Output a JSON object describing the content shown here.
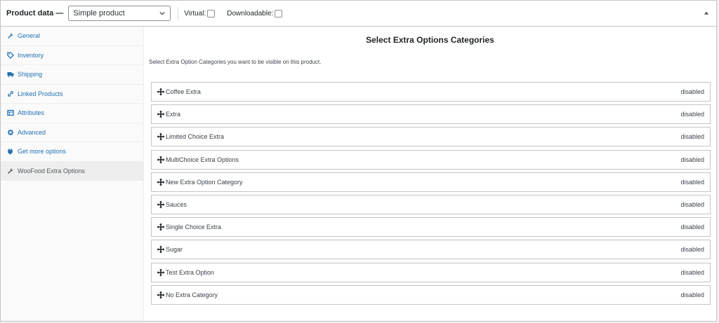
{
  "header": {
    "title": "Product data —",
    "product_type": "Simple product",
    "virtual_label": "Virtual:",
    "downloadable_label": "Downloadable:"
  },
  "sidebar": {
    "items": [
      {
        "label": "General",
        "icon": "wrench-icon"
      },
      {
        "label": "Inventory",
        "icon": "tag-icon"
      },
      {
        "label": "Shipping",
        "icon": "truck-icon"
      },
      {
        "label": "Linked Products",
        "icon": "link-icon"
      },
      {
        "label": "Attributes",
        "icon": "table-icon"
      },
      {
        "label": "Advanced",
        "icon": "gear-icon"
      },
      {
        "label": "Get more options",
        "icon": "plugin-icon"
      },
      {
        "label": "WooFood Extra Options",
        "icon": "wrench-icon"
      }
    ]
  },
  "main": {
    "title": "Select Extra Options Categories",
    "description": "Select Extra Option Categories you want to be visible on this product.",
    "categories": [
      {
        "name": "Coffee Extra",
        "status": "disabled"
      },
      {
        "name": "Extra",
        "status": "disabled"
      },
      {
        "name": "Limited Choice Extra",
        "status": "disabled"
      },
      {
        "name": "MultiChoice Extra Options",
        "status": "disabled"
      },
      {
        "name": "New Extra Option Category",
        "status": "disabled"
      },
      {
        "name": "Sauces",
        "status": "disabled"
      },
      {
        "name": "Single Choice Extra",
        "status": "disabled"
      },
      {
        "name": "Sugar",
        "status": "disabled"
      },
      {
        "name": "Test Extra Option",
        "status": "disabled"
      },
      {
        "name": "No Extra Category",
        "status": "disabled"
      }
    ]
  },
  "colors": {
    "link": "#2271b1",
    "border": "#c3c4c7",
    "sidebar_bg": "#fafafa",
    "active_bg": "#eeeeee"
  }
}
